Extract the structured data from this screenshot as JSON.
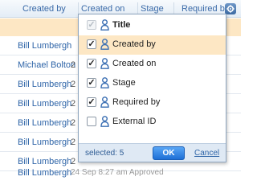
{
  "grid": {
    "columns": [
      {
        "label": "Created by"
      },
      {
        "label": "Created on"
      },
      {
        "label": "Stage"
      },
      {
        "label": "Required by"
      }
    ],
    "rows": [
      {
        "name": "Bill Lumbergh",
        "frag": ""
      },
      {
        "name": "Michael Bolton",
        "frag": "2"
      },
      {
        "name": "Bill Lumbergh",
        "frag": "2"
      },
      {
        "name": "Bill Lumbergh",
        "frag": "2"
      },
      {
        "name": "Bill Lumbergh",
        "frag": "2"
      },
      {
        "name": "Bill Lumbergh",
        "frag": "2"
      },
      {
        "name": "Bill Lumbergh",
        "frag": "2"
      },
      {
        "name": "Bill Lumbergh",
        "frag": "",
        "extra": "24 Sep 8:27 am     Approved"
      }
    ]
  },
  "panel": {
    "options": [
      {
        "label": "Title",
        "checked": true,
        "disabled": true,
        "bold": true
      },
      {
        "label": "Created by",
        "checked": true,
        "highlighted": true
      },
      {
        "label": "Created on",
        "checked": true
      },
      {
        "label": "Stage",
        "checked": true
      },
      {
        "label": "Required by",
        "checked": true
      },
      {
        "label": "External ID",
        "checked": false
      }
    ],
    "selected_label": "selected: 5",
    "ok_label": "OK",
    "cancel_label": "Cancel"
  },
  "colors": {
    "accent": "#2f65a8",
    "highlight": "#fde7c4",
    "footer": "#dfe9f4"
  },
  "icons": {
    "columns_menu": "gear-icon",
    "field": "user-icon"
  }
}
